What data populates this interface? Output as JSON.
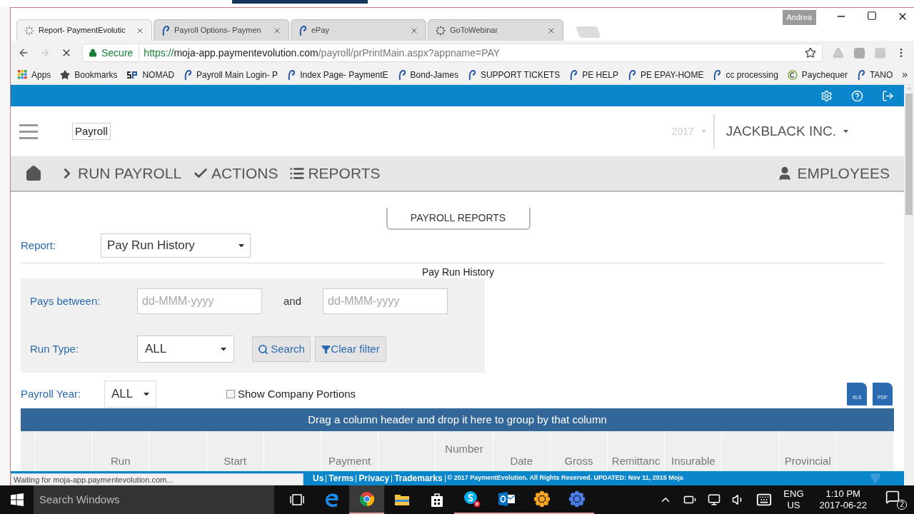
{
  "browser": {
    "profile": "Andrea",
    "tabs": [
      {
        "title": "Report- PaymentEvolutic",
        "kind": "spinner",
        "selected": true
      },
      {
        "title": "Payroll Options- Paymen",
        "kind": "pe",
        "selected": false
      },
      {
        "title": "ePay",
        "kind": "pe",
        "selected": false
      },
      {
        "title": "GoToWebinar",
        "kind": "dots",
        "selected": false
      }
    ],
    "forward_disabled": true,
    "address": {
      "secure_label": "Secure",
      "host": "https://moja-app.paymentevolution.com",
      "path": "/payroll/prPrintMain.aspx?appname=PAY"
    },
    "bookmarks": [
      {
        "label": "Apps",
        "kind": "apps"
      },
      {
        "label": "Bookmarks",
        "kind": "star"
      },
      {
        "label": "NOMAD",
        "kind": "sp"
      },
      {
        "label": "Payroll Main Login- P",
        "kind": "pe"
      },
      {
        "label": "Index Page- PaymentE",
        "kind": "pe"
      },
      {
        "label": "Bond-James",
        "kind": "pe"
      },
      {
        "label": "SUPPORT TICKETS",
        "kind": "pe"
      },
      {
        "label": "PE HELP",
        "kind": "pe"
      },
      {
        "label": "PE EPAY-HOME",
        "kind": "pe"
      },
      {
        "label": "cc processing",
        "kind": "pe"
      },
      {
        "label": "Paychequer",
        "kind": "c"
      },
      {
        "label": "TANO",
        "kind": "pe"
      }
    ],
    "more_bookmarks": "»",
    "status": "Waiting for moja-app.paymentevolution.com..."
  },
  "app": {
    "logo_alt": "Payroll",
    "year": "2017",
    "company": "JACKBLACK INC.",
    "nav": [
      {
        "label": "RUN PAYROLL",
        "kind": "chevron"
      },
      {
        "label": "ACTIONS",
        "kind": "check"
      },
      {
        "label": "REPORTS",
        "kind": "list"
      }
    ],
    "nav_right": "EMPLOYEES",
    "section_button": "PAYROLL REPORTS",
    "report": {
      "label": "Report:",
      "value": "Pay Run History"
    },
    "title": "Pay Run History",
    "filters": {
      "pays_between": "Pays between:",
      "from_placeholder": "dd-MMM-yyyy",
      "and": "and",
      "to_placeholder": "dd-MMM-yyyy",
      "run_type": "Run Type:",
      "run_type_value": "ALL",
      "search": "Search",
      "clear": "Clear filter"
    },
    "payroll_year": {
      "label": "Payroll Year:",
      "value": "ALL"
    },
    "company_portions": {
      "label": "Show Company Portions",
      "checked": false
    },
    "exports": [
      "XLS",
      "PDF"
    ],
    "group_hint": "Drag a column header and drop it here to group by that column",
    "columns": [
      {
        "kind": "blank"
      },
      {
        "kind": "blank"
      },
      {
        "kind": "label",
        "label": "Run"
      },
      {
        "kind": "blank"
      },
      {
        "kind": "label",
        "label": "Start"
      },
      {
        "kind": "blank"
      },
      {
        "kind": "label",
        "label": "Payment"
      },
      {
        "kind": "blank"
      },
      {
        "kind": "top",
        "label": "Number"
      },
      {
        "kind": "label",
        "label": "Date"
      },
      {
        "kind": "label",
        "label": "Gross"
      },
      {
        "kind": "label",
        "label": "Remittanc"
      },
      {
        "kind": "label",
        "label": "Insurable"
      },
      {
        "kind": "blank"
      },
      {
        "kind": "label",
        "label": "Provincial"
      },
      {
        "kind": "blank"
      }
    ],
    "footer": {
      "links": [
        "Us",
        "Terms",
        "Privacy",
        "Trademarks"
      ],
      "text": "© 2017 PaymentEvolution. All Rights Reserved. UPDATED: Nov 11, 2015 Moja"
    }
  },
  "taskbar": {
    "search_placeholder": "Search Windows",
    "apps": [
      {
        "kind": "taskview",
        "selected": false,
        "running": false
      },
      {
        "kind": "edge",
        "selected": false,
        "running": false
      },
      {
        "kind": "chrome",
        "selected": true,
        "running": true
      },
      {
        "kind": "folder",
        "selected": false,
        "running": false
      },
      {
        "kind": "store",
        "selected": false,
        "running": false
      },
      {
        "kind": "skype",
        "selected": false,
        "running": true
      },
      {
        "kind": "outlook",
        "selected": false,
        "running": true
      },
      {
        "kind": "orange-flower",
        "selected": false,
        "running": true
      },
      {
        "kind": "blue-flower",
        "selected": false,
        "running": true
      }
    ],
    "language": "ENG",
    "region": "US",
    "time": "1:10 PM",
    "date": "2017-06-22",
    "notifications": "2"
  }
}
